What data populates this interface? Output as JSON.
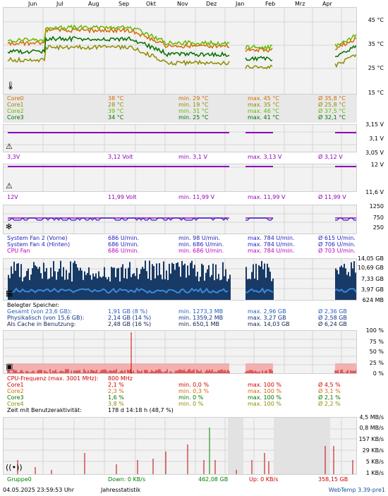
{
  "months": [
    "Jun",
    "Jul",
    "Aug",
    "Sep",
    "Okt",
    "Nov",
    "Dez",
    "Jan",
    "Feb",
    "Mrz",
    "Apr"
  ],
  "temp": {
    "axis": [
      "45 °C",
      "35 °C",
      "25 °C",
      "15 °C"
    ],
    "rows": [
      {
        "name": "Core0",
        "cur": "38 °C",
        "min": "min. 29 °C",
        "max": "max. 45 °C",
        "avg": "Ø 35,8 °C",
        "color": "#d46a00"
      },
      {
        "name": "Core1",
        "cur": "28 °C",
        "min": "min. 19 °C",
        "max": "max. 35 °C",
        "avg": "Ø 25,8 °C",
        "color": "#8c8c00"
      },
      {
        "name": "Core2",
        "cur": "39 °C",
        "min": "min. 31 °C",
        "max": "max. 46 °C",
        "avg": "Ø 37,5 °C",
        "color": "#66b800"
      },
      {
        "name": "Core3",
        "cur": "34 °C",
        "min": "min. 25 °C",
        "max": "max. 41 °C",
        "avg": "Ø 32,1 °C",
        "color": "#007000"
      }
    ]
  },
  "v33": {
    "axis": [
      "3,15 V",
      "3,1 V",
      "3,05 V"
    ],
    "row": {
      "name": "3,3V",
      "cur": "3,12 Volt",
      "min": "min. 3,1 V",
      "max": "max. 3,13 V",
      "avg": "Ø 3,12 V",
      "color": "#9000c0"
    }
  },
  "v12": {
    "axis": [
      "12 V",
      "11,6 V"
    ],
    "row": {
      "name": "12V",
      "cur": "11,99 Volt",
      "min": "min. 11,99 V",
      "max": "max. 11,99 V",
      "avg": "Ø 11,99 V",
      "color": "#9000c0"
    }
  },
  "fans": {
    "axis": [
      "1250",
      "750",
      "250"
    ],
    "rows": [
      {
        "name": "System Fan 2 (Vorne)",
        "cur": "686 U/min.",
        "min": "min. 98 U/min.",
        "max": "max. 784 U/min.",
        "avg": "Ø 615 U/min.",
        "color": "#2020c0"
      },
      {
        "name": "System Fan 4 (Hinten)",
        "cur": "686 U/min.",
        "min": "min. 686 U/min.",
        "max": "max. 784 U/min.",
        "avg": "Ø 706 U/min.",
        "color": "#2020c0"
      },
      {
        "name": "CPU Fan",
        "cur": "686 U/min.",
        "min": "min. 686 U/min.",
        "max": "max. 784 U/min.",
        "avg": "Ø 703 U/min.",
        "color": "#c000c0"
      }
    ]
  },
  "mem": {
    "axis": [
      "14,05 GB",
      "10,69 GB",
      "7,33 GB",
      "3,97 GB",
      "624 MB"
    ],
    "header": "Belegter Speicher:",
    "rows": [
      {
        "name": "Gesamt (von 23,6 GB):",
        "cur": "1,91 GB (8 %)",
        "min": "min. 1273,3 MB",
        "max": "max. 2,96 GB",
        "avg": "Ø 2,36 GB",
        "color": "#2060c0"
      },
      {
        "name": "Physikalisch (von 15,6 GB):",
        "cur": "2,14 GB (14 %)",
        "min": "min. 1359,2 MB",
        "max": "max. 3,27 GB",
        "avg": "Ø 2,58 GB",
        "color": "#103080"
      },
      {
        "name": "Als Cache in Benutzung:",
        "cur": "2,48 GB (16 %)",
        "min": "min. 650,1 MB",
        "max": "max. 14,03 GB",
        "avg": "Ø 6,24 GB",
        "color": "#102050"
      }
    ]
  },
  "cpu": {
    "axis": [
      "100 %",
      "75 %",
      "50 %",
      "25 %",
      "0 %"
    ],
    "rows": [
      {
        "name": "CPU-Frequenz (max. 3001 MHz):",
        "cur": "800 MHz",
        "min": "",
        "max": "",
        "avg": "",
        "color": "#d00000"
      },
      {
        "name": "Core1",
        "cur": "2,1 %",
        "min": "min. 0,0 %",
        "max": "max. 100 %",
        "avg": "Ø 4,5 %",
        "color": "#d00000"
      },
      {
        "name": "Core2",
        "cur": "2,3 %",
        "min": "min. 0,3 %",
        "max": "max. 100 %",
        "avg": "Ø 3,1 %",
        "color": "#d46a00"
      },
      {
        "name": "Core3",
        "cur": "1,6 %",
        "min": "min. 0 %",
        "max": "max. 100 %",
        "avg": "Ø 2,1 %",
        "color": "#007000"
      },
      {
        "name": "Core4",
        "cur": "3,8 %",
        "min": "min. 0 %",
        "max": "max. 100 %",
        "avg": "Ø 2,2 %",
        "color": "#8c8c00"
      }
    ],
    "activity_label": "Zeit mit Benutzeraktivität:",
    "activity_value": "178 d 14:18 h (48,7 %)"
  },
  "net": {
    "axis": [
      "4,5 MB/s",
      "0,8 MB/s",
      "157 KB/s",
      "29 KB/s",
      "5 KB/s",
      "1 KB/s"
    ],
    "group": "Gruppe0",
    "down": "Down: 0 KB/s",
    "down_total": "462,08 GB",
    "up": "Up: 0 KB/s",
    "up_total": "358,15 GB"
  },
  "footer": {
    "datetime": "04.05.2025 23:59:53 Uhr",
    "stat": "Jahresstatistik",
    "version": "WebTemp 3.39-pre1"
  }
}
